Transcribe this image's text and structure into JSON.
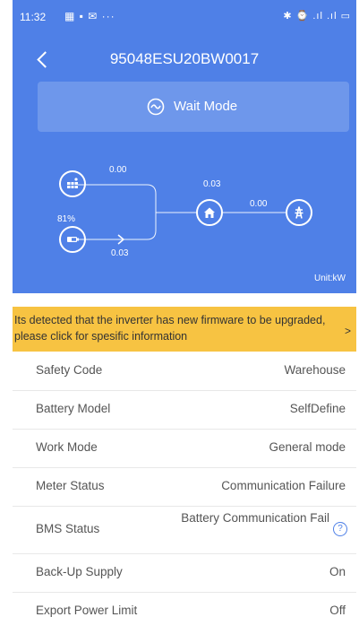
{
  "status_bar": {
    "time": "11:32",
    "left_icons": "▦ ▪ ✉ ···",
    "right_icons": "✱ ⌚ .ıl .ıl ▭"
  },
  "header": {
    "back_icon": "back-chevron-icon",
    "title": "95048ESU20BW0017"
  },
  "mode": {
    "label": "Wait Mode",
    "icon": "wave-circle-icon"
  },
  "diagram": {
    "pv_value": "0.00",
    "battery_soc": "81%",
    "battery_value": "0.03",
    "home_value": "0.03",
    "grid_value": "0.00",
    "unit": "Unit:kW"
  },
  "warning": {
    "text": "Its detected that the inverter has new firmware to be upgraded, please click for spesific information",
    "chevron": ">"
  },
  "details": [
    {
      "key": "Safety Code",
      "value": "Warehouse"
    },
    {
      "key": "Battery Model",
      "value": "SelfDefine"
    },
    {
      "key": "Work Mode",
      "value": "General mode"
    },
    {
      "key": "Meter Status",
      "value": "Communication Failure"
    },
    {
      "key": "BMS Status",
      "value": "Battery Communication Fail",
      "help": "?"
    },
    {
      "key": "Back-Up Supply",
      "value": "On"
    },
    {
      "key": "Export Power Limit",
      "value": "Off"
    }
  ]
}
